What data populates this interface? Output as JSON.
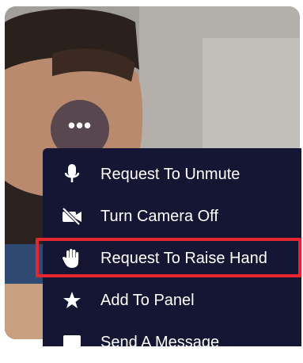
{
  "more_button": {
    "glyph": "•••"
  },
  "menu": {
    "items": [
      {
        "label": "Request To Unmute",
        "icon": "microphone-icon"
      },
      {
        "label": "Turn Camera Off",
        "icon": "camera-off-icon"
      },
      {
        "label": "Request To Raise Hand",
        "icon": "raised-hand-icon",
        "highlighted": true
      },
      {
        "label": "Add To Panel",
        "icon": "star-icon"
      },
      {
        "label": "Send A Message",
        "icon": "message-icon"
      }
    ]
  },
  "colors": {
    "menu_background": "#151633",
    "menu_text": "#ffffff",
    "highlight_border": "#e3262f",
    "more_button_background": "#3c3446"
  }
}
